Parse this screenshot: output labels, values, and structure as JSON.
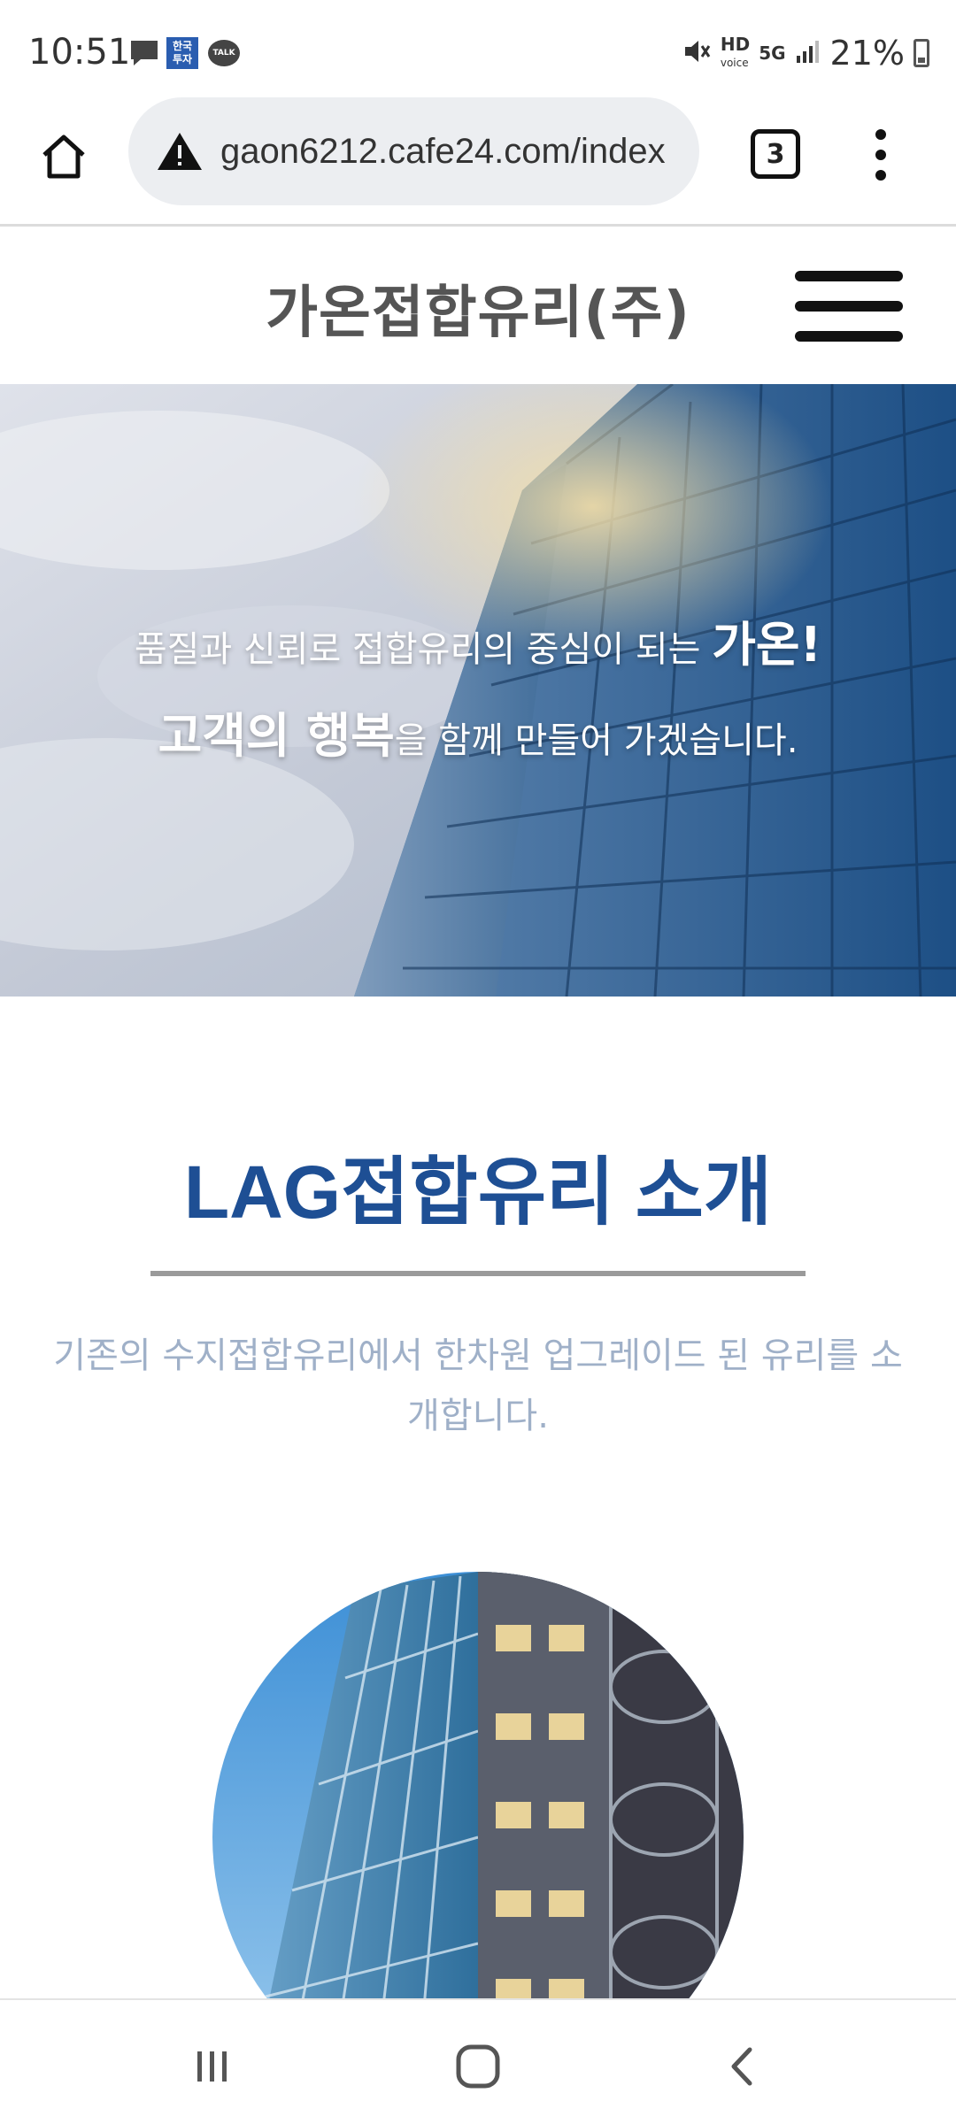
{
  "status_bar": {
    "time": "10:51",
    "notifications": [
      "message-icon",
      "news-icon",
      "kakaotalk-icon"
    ],
    "news_icon_text": "한국\n투자",
    "talk_icon_text": "TALK",
    "network_label": "HD",
    "network_sub": "voice",
    "network_gen": "5G",
    "battery_percent": "21%"
  },
  "browser": {
    "url": "gaon6212.cafe24.com/index",
    "tab_count": "3"
  },
  "site": {
    "title": "가온접합유리(주)"
  },
  "hero": {
    "line1_text": "품질과 신뢰로 접합유리의 중심이 되는 ",
    "line1_emphasis": "가온!",
    "line2_emphasis": "고객의 행복",
    "line2_text": "을 함께 만들어 가겠습니다."
  },
  "intro": {
    "title": "LAG접합유리 소개",
    "description": "기존의 수지접합유리에서 한차원 업그레이드 된 유리를 소개합니다."
  },
  "colors": {
    "accent": "#1e4f94",
    "description_text": "#9fb0c8",
    "title_gray": "#555555"
  }
}
